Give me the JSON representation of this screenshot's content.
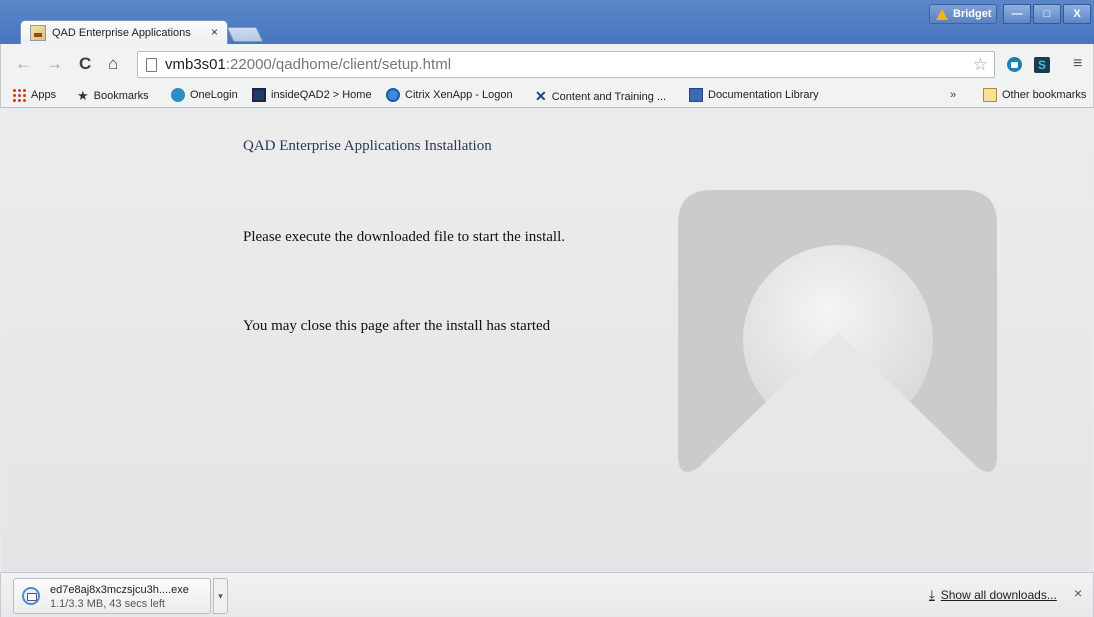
{
  "window": {
    "profile_name": "Bridget",
    "minimize": "—",
    "maximize": "□",
    "close": "X"
  },
  "tab": {
    "title": "QAD Enterprise Applications",
    "close": "×"
  },
  "toolbar": {
    "back": "←",
    "forward": "→",
    "reload": "C",
    "home": "⌂",
    "url_host": "vmb3s01",
    "url_path": ":22000/qadhome/client/setup.html",
    "bookmark_star": "☆",
    "extension_s": "S",
    "menu": "≡"
  },
  "bookmarks": {
    "items": [
      {
        "label": "Apps",
        "icon": "apps-grid-icon"
      },
      {
        "label": "Bookmarks",
        "icon": "star-icon"
      },
      {
        "label": "OneLogin",
        "icon": "onelogin-icon"
      },
      {
        "label": "insideQAD2 > Home",
        "icon": "insideqad-icon"
      },
      {
        "label": "Citrix XenApp - Logon",
        "icon": "citrix-icon"
      },
      {
        "label": "Content and Training ...",
        "icon": "content-training-icon"
      },
      {
        "label": "Documentation Library",
        "icon": "documentation-icon"
      }
    ],
    "overflow": "»",
    "other": "Other bookmarks"
  },
  "page": {
    "heading": "QAD Enterprise Applications Installation",
    "message1": "Please execute the downloaded file to start the install.",
    "message2": "You may close this page after the install has started"
  },
  "downloads": {
    "filename": "ed7e8aj8x3mczsjcu3h....exe",
    "status": "1.1/3.3 MB, 43 secs left",
    "progress_fraction": 0.33,
    "show_all": "Show all downloads...",
    "close": "×",
    "dropdown": "▾"
  },
  "colors": {
    "titlebar": "#4776bd",
    "heading": "#2b3a5a",
    "logo": "#c9cbcc"
  }
}
